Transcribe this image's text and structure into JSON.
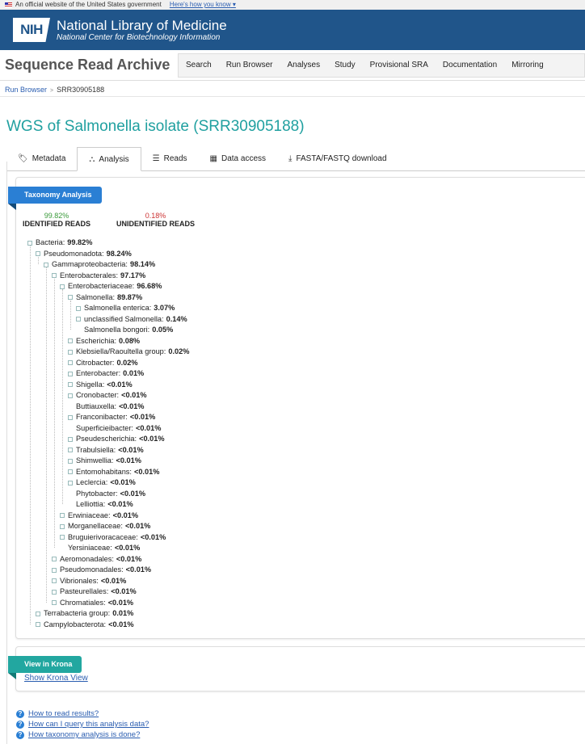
{
  "gov_banner": {
    "text": "An official website of the United States government",
    "link": "Here's how you know"
  },
  "header": {
    "logo": "NIH",
    "title": "National Library of Medicine",
    "subtitle": "National Center for Biotechnology Information"
  },
  "sra": {
    "title": "Sequence Read Archive",
    "nav": [
      "Search",
      "Run Browser",
      "Analyses",
      "Study",
      "Provisional SRA",
      "Documentation",
      "Mirroring"
    ]
  },
  "breadcrumb": {
    "root": "Run Browser",
    "current": "SRR30905188"
  },
  "page_title": "WGS of Salmonella isolate (SRR30905188)",
  "tabs": [
    {
      "label": "Metadata",
      "icon": "tag-icon"
    },
    {
      "label": "Analysis",
      "icon": "sitemap-icon"
    },
    {
      "label": "Reads",
      "icon": "list-icon"
    },
    {
      "label": "Data access",
      "icon": "server-icon"
    },
    {
      "label": "FASTA/FASTQ download",
      "icon": "download-icon"
    }
  ],
  "taxonomy": {
    "ribbon": "Taxonomy Analysis",
    "identified_pct": "99.82%",
    "identified_label": "IDENTIFIED READS",
    "unidentified_pct": "0.18%",
    "unidentified_label": "UNIDENTIFIED READS",
    "colors": {
      "identified": "#3a9a3a",
      "unidentified": "#cc3333",
      "ribbon": "#2a7fd4"
    },
    "tree": [
      {
        "name": "Bacteria:",
        "value": "99.82%",
        "depth": 0,
        "expandable": true
      },
      {
        "name": "Pseudomonadota:",
        "value": "98.24%",
        "depth": 1,
        "expandable": true
      },
      {
        "name": "Gammaproteobacteria:",
        "value": "98.14%",
        "depth": 2,
        "expandable": true
      },
      {
        "name": "Enterobacterales:",
        "value": "97.17%",
        "depth": 3,
        "expandable": true
      },
      {
        "name": "Enterobacteriaceae:",
        "value": "96.68%",
        "depth": 4,
        "expandable": true
      },
      {
        "name": "Salmonella:",
        "value": "89.87%",
        "depth": 5,
        "expandable": true
      },
      {
        "name": "Salmonella enterica:",
        "value": "3.07%",
        "depth": 6,
        "expandable": true
      },
      {
        "name": "unclassified Salmonella:",
        "value": "0.14%",
        "depth": 6,
        "expandable": true
      },
      {
        "name": "Salmonella bongori:",
        "value": "0.05%",
        "depth": 6,
        "expandable": false
      },
      {
        "name": "Escherichia:",
        "value": "0.08%",
        "depth": 5,
        "expandable": true
      },
      {
        "name": "Klebsiella/Raoultella group:",
        "value": "0.02%",
        "depth": 5,
        "expandable": true
      },
      {
        "name": "Citrobacter:",
        "value": "0.02%",
        "depth": 5,
        "expandable": true
      },
      {
        "name": "Enterobacter:",
        "value": "0.01%",
        "depth": 5,
        "expandable": true
      },
      {
        "name": "Shigella:",
        "value": "<0.01%",
        "depth": 5,
        "expandable": true
      },
      {
        "name": "Cronobacter:",
        "value": "<0.01%",
        "depth": 5,
        "expandable": true
      },
      {
        "name": "Buttiauxella:",
        "value": "<0.01%",
        "depth": 5,
        "expandable": false
      },
      {
        "name": "Franconibacter:",
        "value": "<0.01%",
        "depth": 5,
        "expandable": true
      },
      {
        "name": "Superficieibacter:",
        "value": "<0.01%",
        "depth": 5,
        "expandable": false
      },
      {
        "name": "Pseudescherichia:",
        "value": "<0.01%",
        "depth": 5,
        "expandable": true
      },
      {
        "name": "Trabulsiella:",
        "value": "<0.01%",
        "depth": 5,
        "expandable": true
      },
      {
        "name": "Shimwellia:",
        "value": "<0.01%",
        "depth": 5,
        "expandable": true
      },
      {
        "name": "Entomohabitans:",
        "value": "<0.01%",
        "depth": 5,
        "expandable": true
      },
      {
        "name": "Leclercia:",
        "value": "<0.01%",
        "depth": 5,
        "expandable": true
      },
      {
        "name": "Phytobacter:",
        "value": "<0.01%",
        "depth": 5,
        "expandable": false
      },
      {
        "name": "Lelliottia:",
        "value": "<0.01%",
        "depth": 5,
        "expandable": false
      },
      {
        "name": "Erwiniaceae:",
        "value": "<0.01%",
        "depth": 4,
        "expandable": true
      },
      {
        "name": "Morganellaceae:",
        "value": "<0.01%",
        "depth": 4,
        "expandable": true
      },
      {
        "name": "Bruguierivoracaceae:",
        "value": "<0.01%",
        "depth": 4,
        "expandable": true
      },
      {
        "name": "Yersiniaceae:",
        "value": "<0.01%",
        "depth": 4,
        "expandable": false
      },
      {
        "name": "Aeromonadales:",
        "value": "<0.01%",
        "depth": 3,
        "expandable": true
      },
      {
        "name": "Pseudomonadales:",
        "value": "<0.01%",
        "depth": 3,
        "expandable": true
      },
      {
        "name": "Vibrionales:",
        "value": "<0.01%",
        "depth": 3,
        "expandable": true
      },
      {
        "name": "Pasteurellales:",
        "value": "<0.01%",
        "depth": 3,
        "expandable": true
      },
      {
        "name": "Chromatiales:",
        "value": "<0.01%",
        "depth": 3,
        "expandable": true
      },
      {
        "name": "Terrabacteria group:",
        "value": "0.01%",
        "depth": 1,
        "expandable": true
      },
      {
        "name": "Campylobacterota:",
        "value": "<0.01%",
        "depth": 1,
        "expandable": true
      }
    ]
  },
  "krona": {
    "ribbon": "View in Krona",
    "link": "Show Krona View",
    "ribbon_color": "#22a7a0"
  },
  "help": [
    "How to read results?",
    "How can I query this analysis data?",
    "How taxonomy analysis is done?"
  ]
}
